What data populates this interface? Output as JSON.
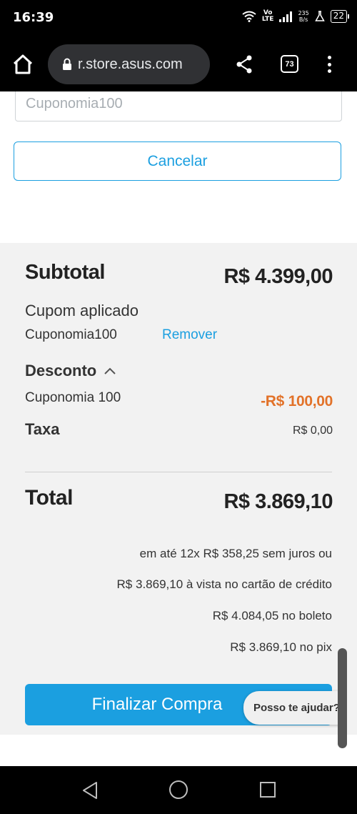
{
  "status_bar": {
    "time": "16:39",
    "network_top": "Vo",
    "network_bottom": "LTE",
    "speed_top": "235",
    "speed_bottom": "B/s",
    "battery": "22"
  },
  "browser": {
    "url": "r.store.asus.com",
    "tab_count": "73"
  },
  "coupon": {
    "input_value": "Cuponomia100",
    "cancel_label": "Cancelar"
  },
  "summary": {
    "subtotal_label": "Subtotal",
    "subtotal_value": "R$ 4.399,00",
    "coupon_applied_label": "Cupom aplicado",
    "coupon_name": "Cuponomia100",
    "remove_label": "Remover",
    "discount_label": "Desconto",
    "discount_name": "Cuponomia 100",
    "discount_value": "-R$ 100,00",
    "tax_label": "Taxa",
    "tax_value": "R$ 0,00",
    "total_label": "Total",
    "total_value": "R$ 3.869,10",
    "payment_lines": [
      "em até 12x R$ 358,25 sem juros ou",
      "R$ 3.869,10 à vista no cartão de crédito",
      "R$ 4.084,05 no boleto",
      "R$ 3.869,10 no pix"
    ],
    "checkout_label": "Finalizar Compra",
    "help_label": "Posso te ajudar?"
  },
  "colors": {
    "accent": "#1b9fe0",
    "discount": "#e27229",
    "summary_bg": "#f2f2f2"
  }
}
